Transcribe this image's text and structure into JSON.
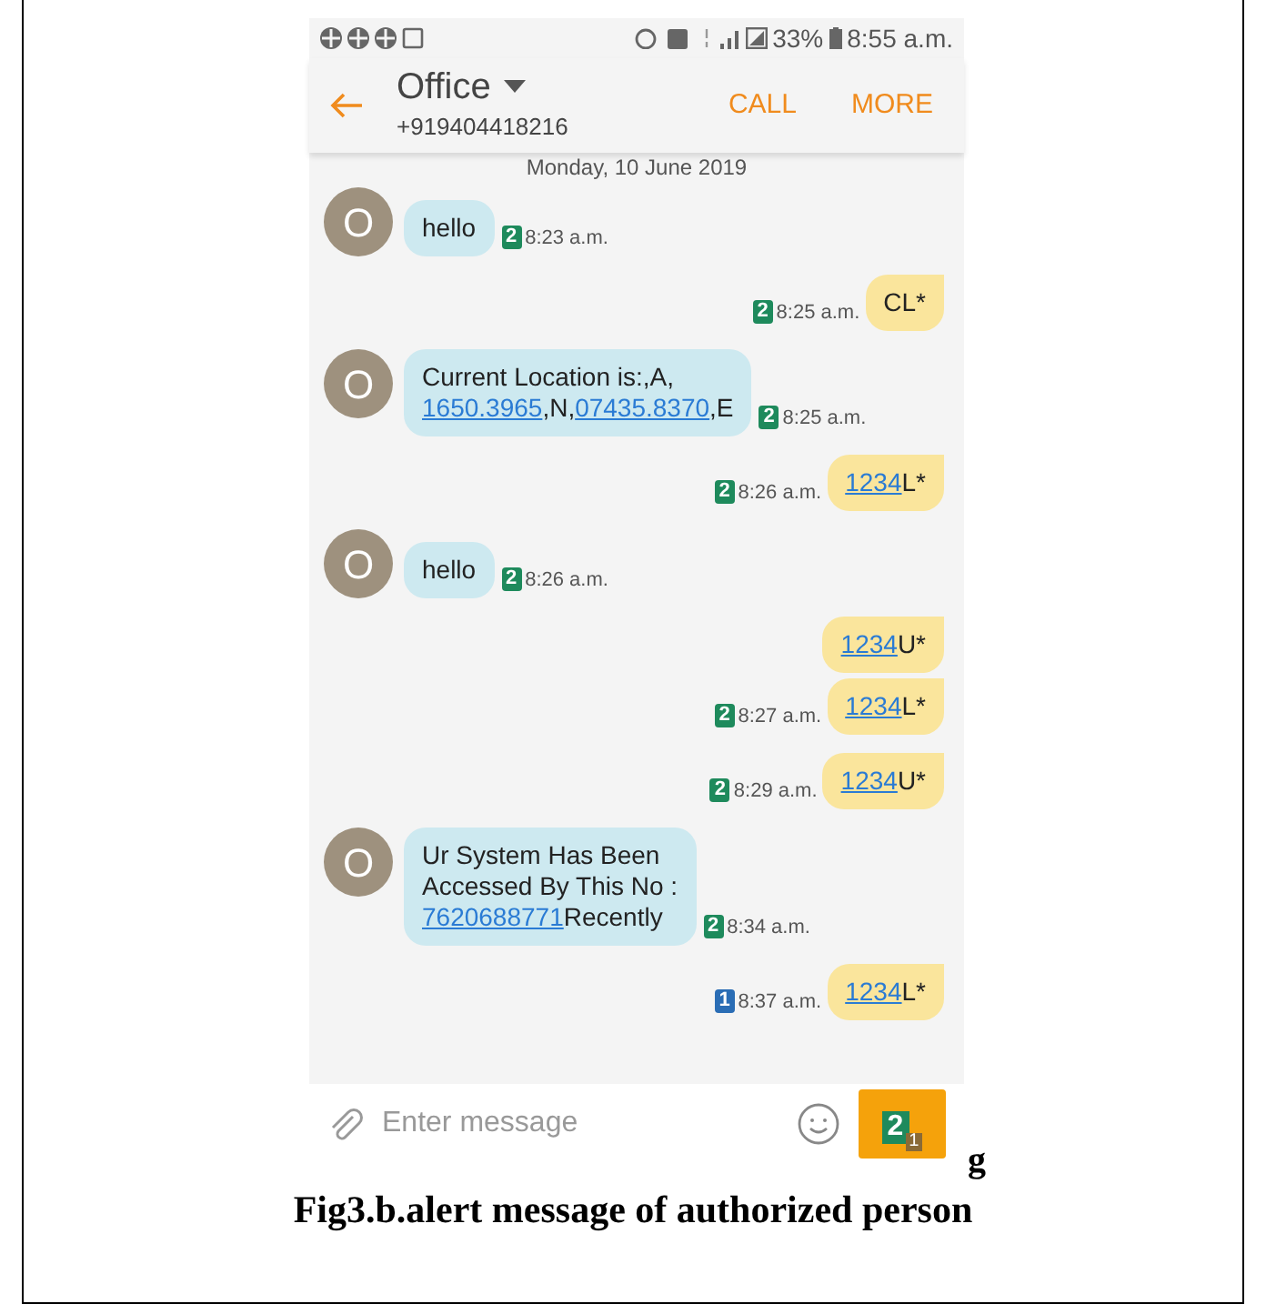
{
  "status_bar": {
    "battery": "33%",
    "time": "8:55 a.m."
  },
  "header": {
    "title": "Office",
    "number": "+919404418216",
    "actions": [
      "CALL",
      "MORE"
    ]
  },
  "date": "Monday, 10 June 2019",
  "messages": [
    {
      "kind": "incoming",
      "avatar": "O",
      "parts": [
        {
          "text": "hello",
          "link": false
        }
      ],
      "sim": "2",
      "color": "#1e8a5c",
      "time": "8:23 a.m."
    },
    {
      "kind": "outgoing",
      "parts": [
        {
          "text": "CL*",
          "link": false
        }
      ],
      "sim": "2",
      "color": "#1e8a5c",
      "time": "8:25 a.m."
    },
    {
      "kind": "incoming",
      "avatar": "O",
      "parts": [
        {
          "text": "Current Location is:,A,\n",
          "link": false
        },
        {
          "text": "1650.3965",
          "link": true
        },
        {
          "text": ",N,",
          "link": false
        },
        {
          "text": "07435.8370",
          "link": true
        },
        {
          "text": ",E",
          "link": false
        }
      ],
      "sim": "2",
      "color": "#1e8a5c",
      "time": "8:25 a.m."
    },
    {
      "kind": "outgoing",
      "parts": [
        {
          "text": "1234",
          "link": true
        },
        {
          "text": "L*",
          "link": false
        }
      ],
      "sim": "2",
      "color": "#1e8a5c",
      "time": "8:26 a.m."
    },
    {
      "kind": "incoming",
      "avatar": "O",
      "parts": [
        {
          "text": "hello",
          "link": false
        }
      ],
      "sim": "2",
      "color": "#1e8a5c",
      "time": "8:26 a.m."
    },
    {
      "kind": "outgoing",
      "parts": [
        {
          "text": "1234",
          "link": true
        },
        {
          "text": "U*",
          "link": false
        }
      ]
    },
    {
      "kind": "outgoing",
      "parts": [
        {
          "text": "1234",
          "link": true
        },
        {
          "text": "L*",
          "link": false
        }
      ],
      "sim": "2",
      "color": "#1e8a5c",
      "time": "8:27 a.m."
    },
    {
      "kind": "outgoing",
      "parts": [
        {
          "text": "1234",
          "link": true
        },
        {
          "text": "U*",
          "link": false
        }
      ],
      "sim": "2",
      "color": "#1e8a5c",
      "time": "8:29 a.m."
    },
    {
      "kind": "incoming",
      "avatar": "O",
      "parts": [
        {
          "text": "Ur System Has Been\nAccessed By This No :\n",
          "link": false
        },
        {
          "text": "7620688771",
          "link": true
        },
        {
          "text": "Recently",
          "link": false
        }
      ],
      "sim": "2",
      "color": "#1e8a5c",
      "time": "8:34 a.m."
    },
    {
      "kind": "outgoing",
      "parts": [
        {
          "text": "1234",
          "link": true
        },
        {
          "text": "L*",
          "link": false
        }
      ],
      "sim": "1",
      "color": "#2a6db5",
      "time": "8:37 a.m."
    }
  ],
  "composer": {
    "placeholder": "Enter message",
    "send_sim": "2",
    "send_sim_alt": "1"
  },
  "stray_letter": "g",
  "caption": "Fig3.b.alert message of authorized person"
}
